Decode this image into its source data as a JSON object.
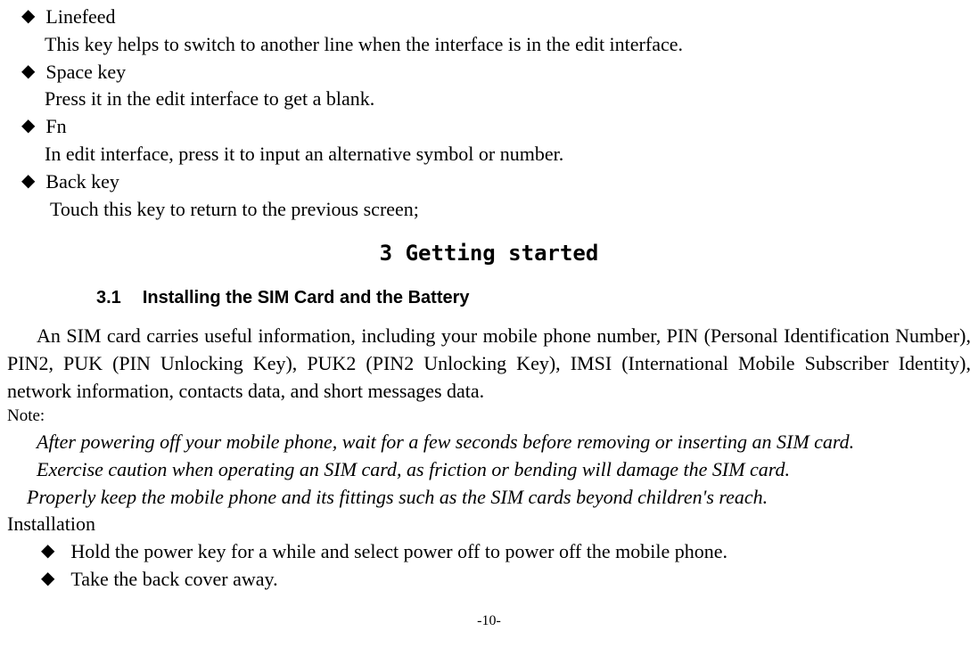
{
  "bullets": {
    "linefeed": {
      "title": "Linefeed",
      "desc": "This key helps to switch to another line when the interface is in the edit interface."
    },
    "space": {
      "title": "Space key",
      "desc": "Press it in the edit interface to get a blank."
    },
    "fn": {
      "title": "Fn",
      "desc": "In edit interface, press it to input an alternative symbol or number."
    },
    "back": {
      "title": "Back key",
      "desc": "Touch this key to return to the previous screen;"
    }
  },
  "section": {
    "title": "3 Getting started"
  },
  "subsection": {
    "number": "3.1",
    "title": "Installing the SIM Card and the Battery"
  },
  "paragraph": "An SIM card carries useful information, including your mobile phone number, PIN (Personal Identification Number), PIN2, PUK (PIN Unlocking Key), PUK2 (PIN2 Unlocking Key), IMSI (International Mobile Subscriber Identity), network information, contacts data, and short messages data.",
  "note_label": "Note:",
  "notes": {
    "n1": "After powering off your mobile phone, wait for a few seconds before removing or inserting an SIM card.",
    "n2": "Exercise caution when operating an SIM card, as friction or bending will damage the SIM card.",
    "n3": "Properly keep the mobile phone and its fittings such as the SIM cards beyond children's reach."
  },
  "installation": {
    "label": "Installation",
    "items": {
      "i1": "Hold the power key for a while and select power off to power off the mobile phone.",
      "i2": "Take the back cover away."
    }
  },
  "page_num": "-10-"
}
